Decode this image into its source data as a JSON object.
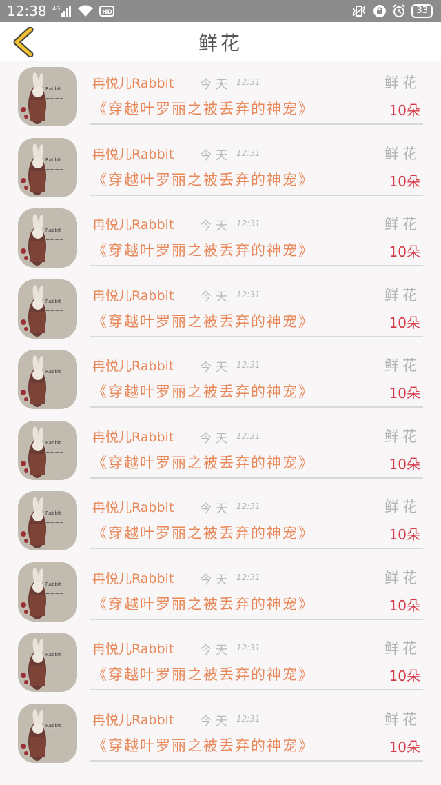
{
  "status_bar": {
    "time": "12:38",
    "network": "4G",
    "hd": "HD",
    "battery": "33"
  },
  "header": {
    "title": "鲜花"
  },
  "list": {
    "items": [
      {
        "name": "冉悦儿Rabbit",
        "date": "今天",
        "time": "12:31",
        "gift_type": "鲜花",
        "book": "《穿越叶罗丽之被丢弃的神宠》",
        "quantity": "10朵"
      },
      {
        "name": "冉悦儿Rabbit",
        "date": "今天",
        "time": "12:31",
        "gift_type": "鲜花",
        "book": "《穿越叶罗丽之被丢弃的神宠》",
        "quantity": "10朵"
      },
      {
        "name": "冉悦儿Rabbit",
        "date": "今天",
        "time": "12:31",
        "gift_type": "鲜花",
        "book": "《穿越叶罗丽之被丢弃的神宠》",
        "quantity": "10朵"
      },
      {
        "name": "冉悦儿Rabbit",
        "date": "今天",
        "time": "12:31",
        "gift_type": "鲜花",
        "book": "《穿越叶罗丽之被丢弃的神宠》",
        "quantity": "10朵"
      },
      {
        "name": "冉悦儿Rabbit",
        "date": "今天",
        "time": "12:31",
        "gift_type": "鲜花",
        "book": "《穿越叶罗丽之被丢弃的神宠》",
        "quantity": "10朵"
      },
      {
        "name": "冉悦儿Rabbit",
        "date": "今天",
        "time": "12:31",
        "gift_type": "鲜花",
        "book": "《穿越叶罗丽之被丢弃的神宠》",
        "quantity": "10朵"
      },
      {
        "name": "冉悦儿Rabbit",
        "date": "今天",
        "time": "12:31",
        "gift_type": "鲜花",
        "book": "《穿越叶罗丽之被丢弃的神宠》",
        "quantity": "10朵"
      },
      {
        "name": "冉悦儿Rabbit",
        "date": "今天",
        "time": "12:31",
        "gift_type": "鲜花",
        "book": "《穿越叶罗丽之被丢弃的神宠》",
        "quantity": "10朵"
      },
      {
        "name": "冉悦儿Rabbit",
        "date": "今天",
        "time": "12:31",
        "gift_type": "鲜花",
        "book": "《穿越叶罗丽之被丢弃的神宠》",
        "quantity": "10朵"
      },
      {
        "name": "冉悦儿Rabbit",
        "date": "今天",
        "time": "12:31",
        "gift_type": "鲜花",
        "book": "《穿越叶罗丽之被丢弃的神宠》",
        "quantity": "10朵"
      }
    ]
  },
  "colors": {
    "accent": "#e8885a",
    "quantity": "#d63a48",
    "muted": "#b5b5b5",
    "back_icon": "#f2c230"
  },
  "icons": {
    "back": "chevron-left-icon",
    "wifi": "wifi-icon",
    "signal": "signal-icon"
  }
}
